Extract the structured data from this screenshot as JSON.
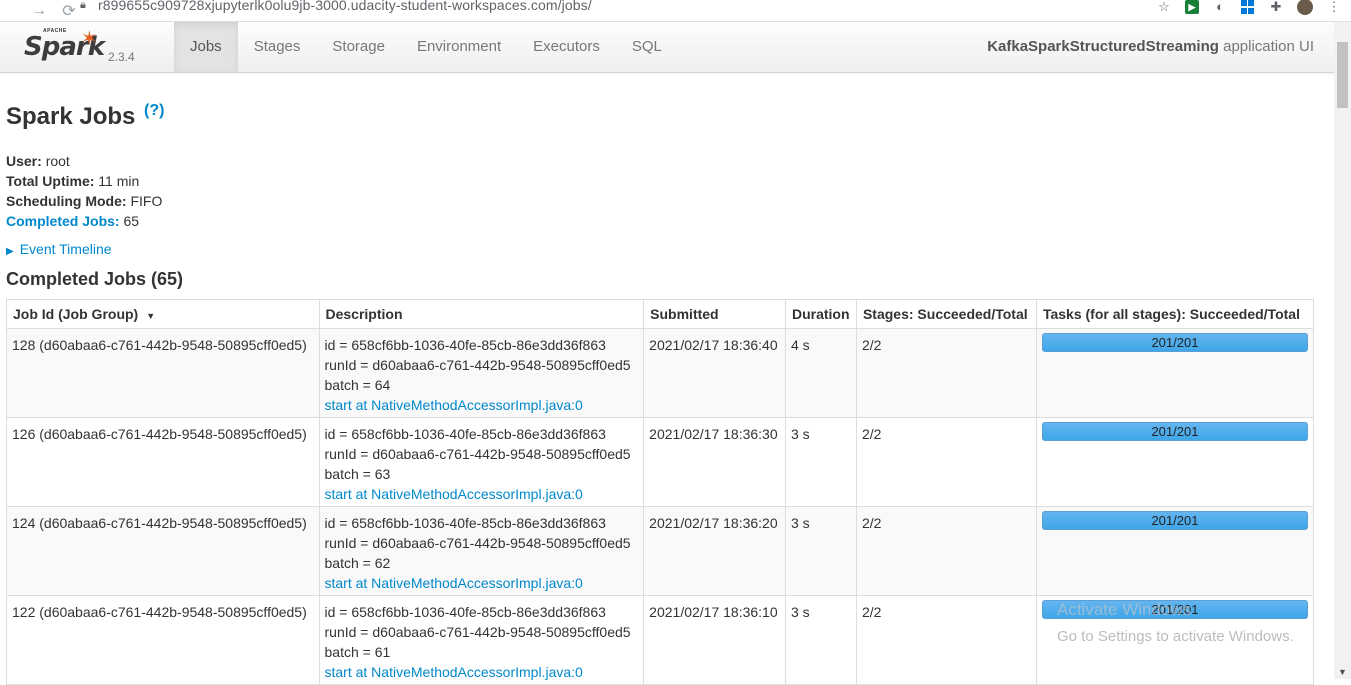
{
  "browser": {
    "url": "r899655c909728xjupyterlk0olu9jb-3000.udacity-student-workspaces.com/jobs/"
  },
  "navbar": {
    "brand_apache": "APACHE",
    "brand_name": "Spark",
    "version": "2.3.4",
    "tabs": [
      {
        "label": "Jobs",
        "active": true
      },
      {
        "label": "Stages"
      },
      {
        "label": "Storage"
      },
      {
        "label": "Environment"
      },
      {
        "label": "Executors"
      },
      {
        "label": "SQL"
      }
    ],
    "app_name": "KafkaSparkStructuredStreaming",
    "app_suffix": "application UI"
  },
  "page": {
    "title": "Spark Jobs",
    "help": "(?)",
    "summary": {
      "user_label": "User:",
      "user_value": "root",
      "uptime_label": "Total Uptime:",
      "uptime_value": "11 min",
      "sched_label": "Scheduling Mode:",
      "sched_value": "FIFO",
      "completed_label": "Completed Jobs:",
      "completed_value": "65"
    },
    "timeline_label": "Event Timeline",
    "section_title": "Completed Jobs (65)"
  },
  "table": {
    "headers": [
      "Job Id (Job Group)",
      "Description",
      "Submitted",
      "Duration",
      "Stages: Succeeded/Total",
      "Tasks (for all stages): Succeeded/Total"
    ],
    "rows": [
      {
        "job": "128 (d60abaa6-c761-442b-9548-50895cff0ed5)",
        "id": "id = 658cf6bb-1036-40fe-85cb-86e3dd36f863",
        "runid": "runId = d60abaa6-c761-442b-9548-50895cff0ed5",
        "batch": "batch = 64",
        "link": "start at NativeMethodAccessorImpl.java:0",
        "submitted": "2021/02/17 18:36:40",
        "duration": "4 s",
        "stages": "2/2",
        "tasks": "201/201"
      },
      {
        "job": "126 (d60abaa6-c761-442b-9548-50895cff0ed5)",
        "id": "id = 658cf6bb-1036-40fe-85cb-86e3dd36f863",
        "runid": "runId = d60abaa6-c761-442b-9548-50895cff0ed5",
        "batch": "batch = 63",
        "link": "start at NativeMethodAccessorImpl.java:0",
        "submitted": "2021/02/17 18:36:30",
        "duration": "3 s",
        "stages": "2/2",
        "tasks": "201/201"
      },
      {
        "job": "124 (d60abaa6-c761-442b-9548-50895cff0ed5)",
        "id": "id = 658cf6bb-1036-40fe-85cb-86e3dd36f863",
        "runid": "runId = d60abaa6-c761-442b-9548-50895cff0ed5",
        "batch": "batch = 62",
        "link": "start at NativeMethodAccessorImpl.java:0",
        "submitted": "2021/02/17 18:36:20",
        "duration": "3 s",
        "stages": "2/2",
        "tasks": "201/201"
      },
      {
        "job": "122 (d60abaa6-c761-442b-9548-50895cff0ed5)",
        "id": "id = 658cf6bb-1036-40fe-85cb-86e3dd36f863",
        "runid": "runId = d60abaa6-c761-442b-9548-50895cff0ed5",
        "batch": "batch = 61",
        "link": "start at NativeMethodAccessorImpl.java:0",
        "submitted": "2021/02/17 18:36:10",
        "duration": "3 s",
        "stages": "2/2",
        "tasks": "201/201"
      }
    ]
  },
  "watermark": {
    "line1": "Activate Windows",
    "line2": "Go to Settings to activate Windows."
  },
  "colors": {
    "accent": "#0088cc",
    "progress": "#3ea6e8",
    "spark_orange": "#e25a1c"
  }
}
